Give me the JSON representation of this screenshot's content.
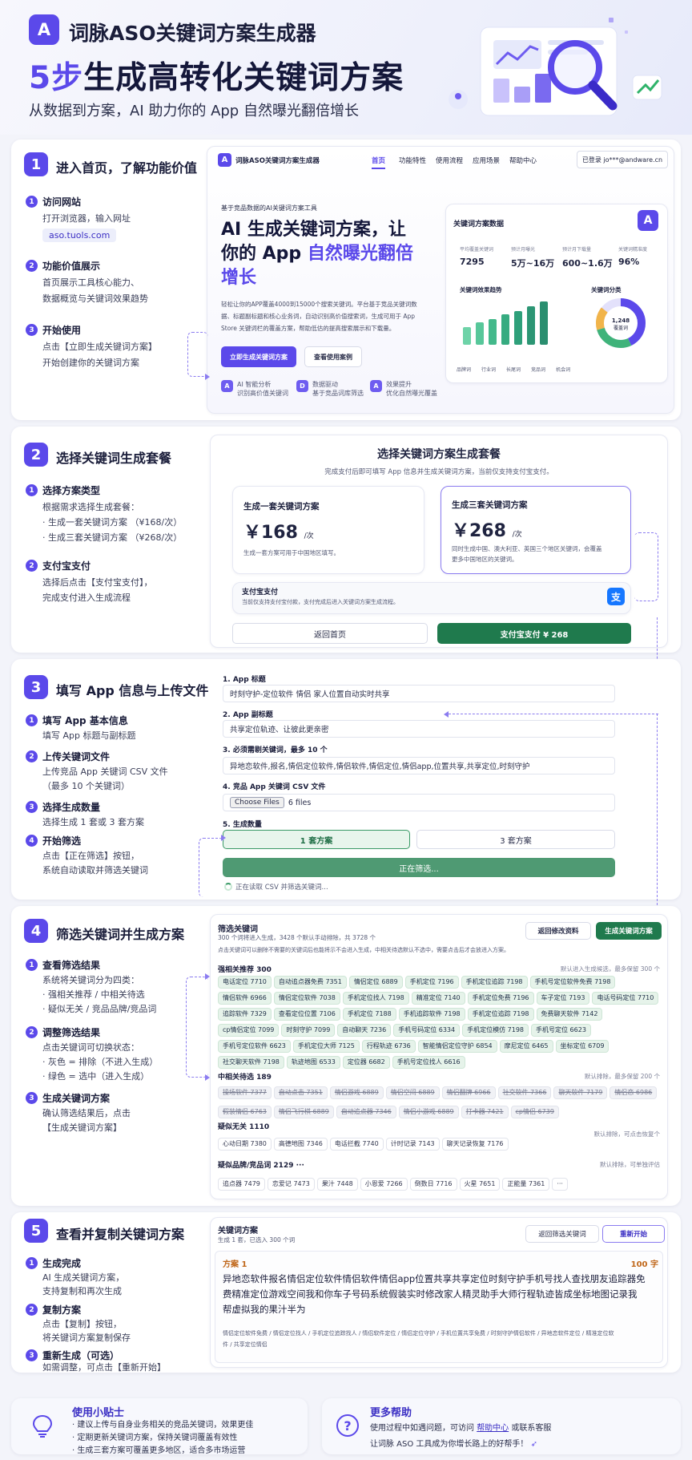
{
  "header": {
    "logo_letter": "A",
    "brand": "词脉ASO关键词方案生成器",
    "headline_accent": "5步",
    "headline_rest": "生成高转化关键词方案",
    "subhead": "从数据到方案，AI 助力你的 App 自然曝光翻倍增长"
  },
  "step1": {
    "num": "1",
    "title": "进入首页，了解功能价值",
    "items": [
      {
        "num": "1",
        "title": "访问网站",
        "lines": [
          "打开浏览器，输入网址"
        ],
        "chip": "aso.tuols.com"
      },
      {
        "num": "2",
        "title": "功能价值展示",
        "lines": [
          "首页展示工具核心能力、",
          "数据概览与关键词效果趋势"
        ]
      },
      {
        "num": "3",
        "title": "开始使用",
        "lines": [
          "点击【立即生成关键词方案】",
          "开始创建你的关键词方案"
        ]
      }
    ],
    "site": {
      "logo": "A",
      "name": "词脉ASO关键词方案生成器",
      "nav": [
        "首页",
        "功能特性",
        "使用流程",
        "应用场景",
        "帮助中心"
      ],
      "login": "已登录 jo***@andware.cn",
      "tag": "基于竞品数据的AI关键词方案工具",
      "title_l1": "AI 生成关键词方案，让",
      "title_l2a": "你的 App ",
      "title_l2b": "自然曝光翻倍",
      "title_l3": "增长",
      "desc_lines": [
        "轻松让你的APP覆盖4000到15000个搜索关键词。平台基于竞品关键词数",
        "据、标题副标题和核心业务词，自动识别高价值搜索词，生成可用于 App",
        "Store 关键词栏的覆盖方案，帮助低估的提高搜索展示和下载量。"
      ],
      "cta": "立即生成关键词方案",
      "cta2": "查看使用案例",
      "features": [
        {
          "icon": "A",
          "l1": "AI 智能分析",
          "l2": "识别高价值关键词"
        },
        {
          "icon": "D",
          "l1": "数据驱动",
          "l2": "基于竞品词库筛选"
        },
        {
          "icon": "A",
          "l1": "效果提升",
          "l2": "优化自然曝光覆盖"
        }
      ],
      "dash": {
        "title": "关键词方案数据",
        "badge": "A",
        "stats": [
          {
            "label": "平均覆盖关键词",
            "value": "7295"
          },
          {
            "label": "预计月曝光",
            "value": "5万~16万"
          },
          {
            "label": "预计月下载量",
            "value": "600~1.6万"
          },
          {
            "label": "关键词精准度",
            "value": "96%"
          }
        ],
        "trend_title": "关键词效果趋势",
        "pie_title": "关键词分类",
        "pie_value": "1,248",
        "pie_label": "覆盖词",
        "legend": [
          "品牌词",
          "行业词",
          "长尾词",
          "竞品词",
          "机会词"
        ]
      }
    }
  },
  "step2": {
    "num": "2",
    "title": "选择关键词生成套餐",
    "items": [
      {
        "num": "1",
        "title": "选择方案类型",
        "lines": [
          "根据需求选择生成套餐：",
          "· 生成一套关键词方案 （¥168/次）",
          "· 生成三套关键词方案 （¥268/次）"
        ]
      },
      {
        "num": "2",
        "title": "支付宝支付",
        "lines": [
          "选择后点击【支付宝支付】，",
          "完成支付进入生成流程"
        ]
      }
    ],
    "panel": {
      "title": "选择关键词方案生成套餐",
      "sub": "完成支付后即可填写 App 信息并生成关键词方案，当前仅支持支付宝支付。",
      "plan1": {
        "name": "生成一套关键词方案",
        "price": "￥168",
        "unit": "/次",
        "desc": "生成一套方案可用于中国地区填写。"
      },
      "plan2": {
        "name": "生成三套关键词方案",
        "price": "￥268",
        "unit": "/次",
        "desc1": "同时生成中国、澳大利亚、英国三个地区关键词，会覆盖",
        "desc2": "更多中国地区的关键词。"
      },
      "pay_title": "支付宝支付",
      "pay_desc": "当前仅支持支付宝付款，支付完成后进入关键词方案生成流程。",
      "pay_icon": "支",
      "back": "返回首页",
      "pay_btn": "支付宝支付 ¥ 268"
    }
  },
  "step3": {
    "num": "3",
    "title": "填写 App 信息与上传文件",
    "items": [
      {
        "num": "1",
        "title": "填写 App 基本信息",
        "lines": [
          "填写 App 标题与副标题"
        ]
      },
      {
        "num": "2",
        "title": "上传关键词文件",
        "lines": [
          "上传竞品 App 关键词 CSV 文件",
          "（最多 10 个关键词）"
        ]
      },
      {
        "num": "3",
        "title": "选择生成数量",
        "lines": [
          "选择生成 1 套或 3 套方案"
        ]
      },
      {
        "num": "4",
        "title": "开始筛选",
        "lines": [
          "点击【正在筛选】按钮，",
          "系统自动读取并筛选关键词"
        ]
      }
    ],
    "form": {
      "l1": "1. App 标题",
      "v1": "时刻守护-定位软件 情侣 家人位置自动实时共享",
      "l2": "2. App 副标题",
      "v2": "共享定位轨迹、让彼此更亲密",
      "l3": "3. 必须需剔关键词，最多 10 个",
      "v3": "异地恋软件,报名,情侣定位软件,情侣软件,情侣定位,情侣app,位置共享,共享定位,时刻守护",
      "l4": "4. 竞品 App 关键词 CSV 文件",
      "file_btn": "Choose Files",
      "file_txt": "6 files",
      "l5": "5. 生成数量",
      "opt1": "1 套方案",
      "opt2": "3 套方案",
      "submit": "正在筛选...",
      "status": "正在读取 CSV 并筛选关键词..."
    }
  },
  "step4": {
    "num": "4",
    "title": "筛选关键词并生成方案",
    "items": [
      {
        "num": "1",
        "title": "查看筛选结果",
        "lines": [
          "系统将关键词分为四类：",
          "· 强相关推荐 / 中相关待选",
          "· 疑似无关 / 竞品品牌/竞品词"
        ]
      },
      {
        "num": "2",
        "title": "调整筛选结果",
        "lines": [
          "点击关键词可切换状态：",
          "· 灰色 = 排除（不进入生成）",
          "· 绿色 = 选中（进入生成）"
        ]
      },
      {
        "num": "3",
        "title": "生成关键词方案",
        "lines": [
          "确认筛选结果后，点击",
          "【生成关键词方案】"
        ]
      }
    ],
    "panel": {
      "title": "筛选关键词",
      "sub": "300 个词将进入生成，3428 个默认手动排除，共 3728 个",
      "hint": "点击关键词可以删除不需要的关键词后也能将示不会进入生成，中相关待选默认不选中，需要点击后才会放进入方案。",
      "back": "返回修改资料",
      "gen": "生成关键词方案",
      "g1": {
        "title": "强相关推荐 300",
        "note": "默认进入生成候选，最多保留 300 个",
        "chips": [
          "电话定位 7710",
          "自动追点器免费 7351",
          "情侣定位 6889",
          "手机定位 7196",
          "手机定位追踪 7198",
          "手机号定位软件免费 7198",
          "情侣软件 6966",
          "情侣定位软件 7038",
          "手机定位找人 7198",
          "精准定位 7140",
          "手机定位免费 7196",
          "车子定位 7193",
          "电话号码定位 7710",
          "追踪软件 7329",
          "查看定位位置 7106",
          "手机定位 7188",
          "手机追踪软件 7198",
          "手机定位追踪 7198",
          "免费聊天软件 7142",
          "cp情侣定位 7099",
          "时刻守护 7099",
          "自动聊天 7236",
          "手机号码定位 6334",
          "手机定位模仿 7198",
          "手机号定位 6623",
          "手机号定位软件 6623",
          "手机定位大师 7125",
          "行程轨迹 6736",
          "智能情侣定位守护 6854",
          "摩尼定位 6465",
          "坐标定位 6709",
          "社交聊天软件 7198",
          "轨迹地图 6533",
          "定位器 6682",
          "手机号定位找人 6616"
        ]
      },
      "g2": {
        "title": "中相关待选 189",
        "note": "默认排除，最多保留 200 个",
        "chips": [
          "操场软件 7377",
          "自动点击 7351",
          "情侣游戏 6889",
          "情侣空间 6889",
          "情侣翻牌 6966",
          "社交软件 7366",
          "聊天软件 7179",
          "情侣恋 6986",
          "假装情侣 6763",
          "情侣飞行棋 6889",
          "自动追点器 7346",
          "情侣小游戏 6889",
          "打卡器 7421",
          "cp情侣 6739"
        ]
      },
      "g3": {
        "title": "疑似无关 1110",
        "note": "默认排除，可点击恢复个",
        "chips": [
          "心动日期 7380",
          "高德地图 7346",
          "电话拦截 7740",
          "计时记录 7143",
          "聊天记录恢复 7176"
        ]
      },
      "g4": {
        "title": "疑似品牌/竞品词 2129 ···",
        "note": "默认排除，可单独评估",
        "chips": [
          "追点器 7479",
          "恋爱记 7473",
          "果汁 7448",
          "小恩爱 7266",
          "倒数日 7716",
          "火星 7651",
          "正能量 7361",
          "···"
        ]
      }
    }
  },
  "step5": {
    "num": "5",
    "title": "查看并复制关键词方案",
    "items": [
      {
        "num": "1",
        "title": "生成完成",
        "lines": [
          "AI 生成关键词方案，",
          "支持复制和再次生成"
        ]
      },
      {
        "num": "2",
        "title": "复制方案",
        "lines": [
          "点击【复制】按钮，",
          "将关键词方案复制保存"
        ]
      },
      {
        "num": "3",
        "title": "重新生成（可选）",
        "lines": [
          "如需调整，可点击【重新开始】",
          "重新生成方案"
        ]
      }
    ],
    "panel": {
      "title": "关键词方案",
      "sub": "生成 1 套，已选入 300 个词",
      "back": "返回筛选关键词",
      "restart": "重新开始",
      "scheme": "方案 1",
      "chars": "100 字",
      "body": [
        "异地恋软件报名情侣定位软件情侣软件情侣app位置共享共享定位时刻守护手机号找人查找朋友追踪器免",
        "费精准定位游戏空间我和你车子号码系统假装实时修改家人精灵助手大师行程轨迹皆成坐标地图记录我",
        "帮虚拟我的果汁半为"
      ],
      "tags": [
        "情侣定位软件免费 / 情侣定位找人 / 手机定位追踪找人 / 情侣软件定位 / 情侣定位守护 / 手机位置共享免费 / 时刻守护情侣软件 / 异地恋软件定位 / 精准定位软",
        "件 / 共享定位情侣"
      ]
    }
  },
  "tips": {
    "title": "使用小贴士",
    "lines": [
      "· 建议上传与自身业务相关的竞品关键词，效果更佳",
      "· 定期更新关键词方案，保持关键词覆盖有效性",
      "· 生成三套方案可覆盖更多地区，适合多市场运营"
    ]
  },
  "help": {
    "title": "更多帮助",
    "l1a": "使用过程中如遇问题，可访问 ",
    "link": "帮助中心",
    "l1b": " 或联系客服",
    "l2": "让词脉 ASO 工具成为你增长路上的好帮手！"
  },
  "colors": {
    "primary": "#5b49ea",
    "green": "#1f7a4d",
    "chipgreen": "#e6f3ea"
  }
}
